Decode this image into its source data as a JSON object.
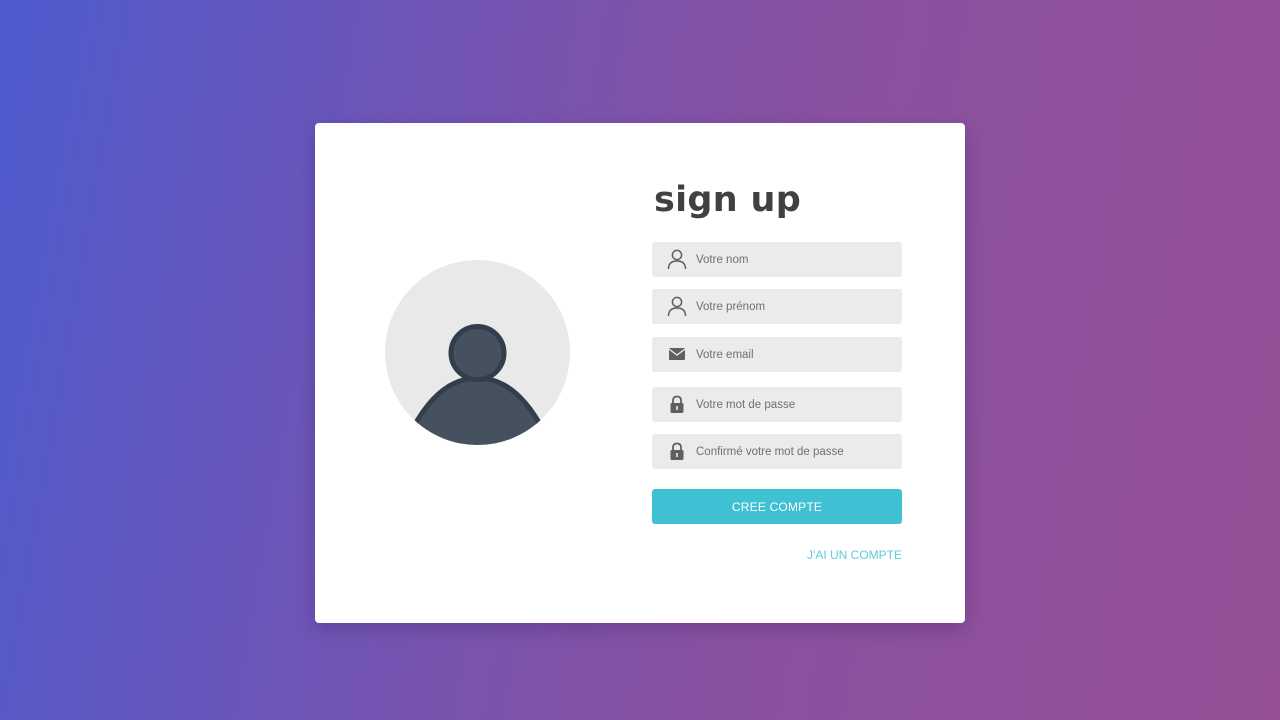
{
  "signup": {
    "title": "sign up",
    "fields": [
      {
        "placeholder": "Votre nom",
        "icon": "user-icon"
      },
      {
        "placeholder": "Votre prénom",
        "icon": "user-icon"
      },
      {
        "placeholder": "Votre email",
        "icon": "envelope-icon"
      },
      {
        "placeholder": "Votre mot de passe",
        "icon": "lock-icon"
      },
      {
        "placeholder": "Confirmé votre mot de passe",
        "icon": "lock-icon"
      }
    ],
    "submit_label": "CREE COMPTE",
    "login_link": "J'AI UN COMPTE",
    "avatar_icon": "user-avatar-icon"
  },
  "colors": {
    "accent": "#3fc1d3",
    "link": "#5fcbdc",
    "field_bg": "#ebebeb",
    "title": "#404142",
    "avatar_bg": "#e9e9e9",
    "avatar_figure": "#45515f",
    "gradient_start": "#4e5bcf",
    "gradient_end": "#955096"
  }
}
